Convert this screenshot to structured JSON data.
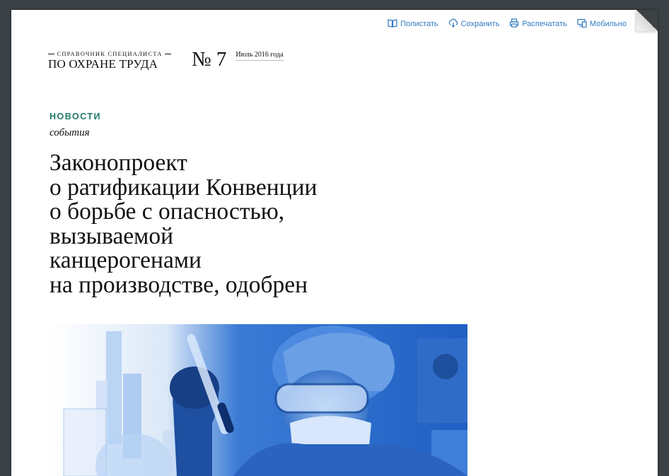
{
  "toolbar": {
    "items": [
      {
        "label": "Полистать",
        "icon": "book-icon"
      },
      {
        "label": "Сохранить",
        "icon": "cloud-download-icon"
      },
      {
        "label": "Распечатать",
        "icon": "printer-icon"
      },
      {
        "label": "Мобильно",
        "icon": "devices-icon"
      }
    ]
  },
  "masthead": {
    "brand_top": "СПРАВОЧНИК СПЕЦИАЛИСТА",
    "brand_main": "ПО ОХРАНЕ ТРУДА",
    "issue_number": "№ 7",
    "issue_date": "Июль 2016 года"
  },
  "article": {
    "section": "НОВОСТИ",
    "subsection": "события",
    "headline": "Законопроект\nо ратификации Конвенции\nо борьбе с опасностью,\nвызываемой\nканцерогенами\nна производстве, одобрен"
  },
  "colors": {
    "background": "#3b4145",
    "link": "#2f79c2",
    "section": "#1c7a6a",
    "photo_tint": "#2f6fcf"
  }
}
